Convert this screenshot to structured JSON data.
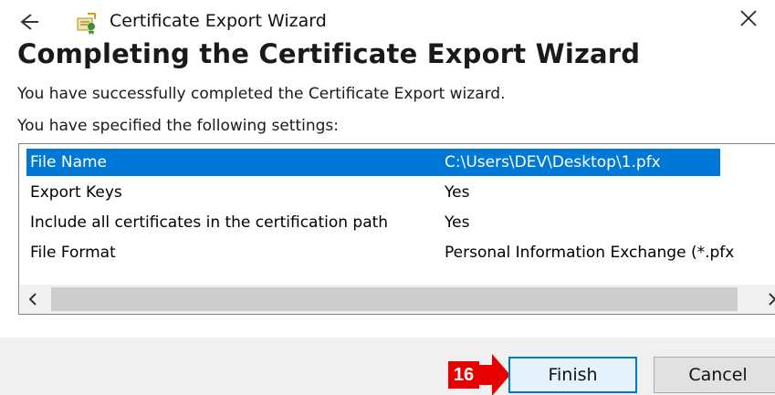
{
  "window": {
    "title": "Certificate Export Wizard",
    "back_icon": "back-arrow-icon",
    "close_icon": "close-icon",
    "app_icon": "certificate-icon"
  },
  "page": {
    "heading": "Completing the Certificate Export Wizard",
    "message_completed": "You have successfully completed the Certificate Export wizard.",
    "message_settings": "You have specified the following settings:"
  },
  "settings": {
    "rows": [
      {
        "name": "File Name",
        "value": "C:\\Users\\DEV\\Desktop\\1.pfx",
        "selected": true
      },
      {
        "name": "Export Keys",
        "value": "Yes",
        "selected": false
      },
      {
        "name": "Include all certificates in the certification path",
        "value": "Yes",
        "selected": false
      },
      {
        "name": "File Format",
        "value": "Personal Information Exchange (*.pfx",
        "selected": false
      }
    ]
  },
  "scrollbar": {
    "left_glyph": "<",
    "right_glyph": ">"
  },
  "annotation": {
    "step_number": "16",
    "badge_color": "#e60000"
  },
  "buttons": {
    "finish_label": "Finish",
    "cancel_label": "Cancel"
  },
  "colors": {
    "selection": "#0078d7",
    "footer_bg": "#f0f0f0"
  }
}
